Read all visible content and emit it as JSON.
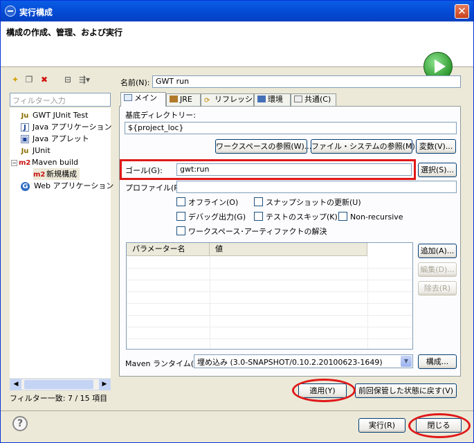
{
  "window": {
    "title": "実行構成"
  },
  "banner": {
    "title": "構成の作成、管理、および実行"
  },
  "left": {
    "filter_placeholder": "フィルター入力",
    "tree": [
      {
        "label": "GWT JUnit Test",
        "icon": "junit-icon"
      },
      {
        "label": "Java アプリケーション",
        "icon": "java-app-icon"
      },
      {
        "label": "Java アプレット",
        "icon": "java-applet-icon"
      },
      {
        "label": "JUnit",
        "icon": "junit-icon"
      },
      {
        "label": "Maven build",
        "icon": "maven-icon"
      },
      {
        "label": "新規構成",
        "icon": "maven-icon"
      },
      {
        "label": "Web アプリケーション",
        "icon": "gwt-icon"
      }
    ],
    "status": "フィルター一致: 7 / 15 項目"
  },
  "form": {
    "name_label": "名前(N):",
    "name_value": "GWT run",
    "tabs": [
      "メイン",
      "JRE",
      "リフレッシュ",
      "環境",
      "共通(C)"
    ],
    "basedir_label": "基底ディレクトリー:",
    "basedir_value": "${project_loc}",
    "btn_workspace": "ワークスペースの参照(W)...",
    "btn_filesystem": "ファイル・システムの参照(M)...",
    "btn_variables": "変数(V)...",
    "goal_label": "ゴール(G):",
    "goal_value": "gwt:run",
    "btn_select": "選択(S)...",
    "profile_label": "プロファイル(P):",
    "profile_value": "",
    "checkboxes": {
      "offline": "オフライン(O)",
      "snapshot": "スナップショットの更新(U)",
      "debug": "デバッグ出力(G)",
      "skip_tests": "テストのスキップ(K)",
      "non_recursive": "Non-recursive",
      "resolve": "ワークスペース･アーティファクトの解決"
    },
    "table_headers": [
      "パラメーター名",
      "値"
    ],
    "btn_add": "追加(A)...",
    "btn_edit": "編集(D)...",
    "btn_remove": "除去(R)",
    "runtime_label": "Maven ランタイム(I):",
    "runtime_value": "埋め込み (3.0-SNAPSHOT/0.10.2.20100623-1649)",
    "btn_configure": "構成...",
    "btn_apply": "適用(Y)",
    "btn_revert": "前回保管した状態に戻す(V)"
  },
  "footer": {
    "btn_run": "実行(R)",
    "btn_close": "閉じる"
  },
  "colors": {
    "highlight": "#e01818",
    "titlebar": "#0449d2"
  }
}
